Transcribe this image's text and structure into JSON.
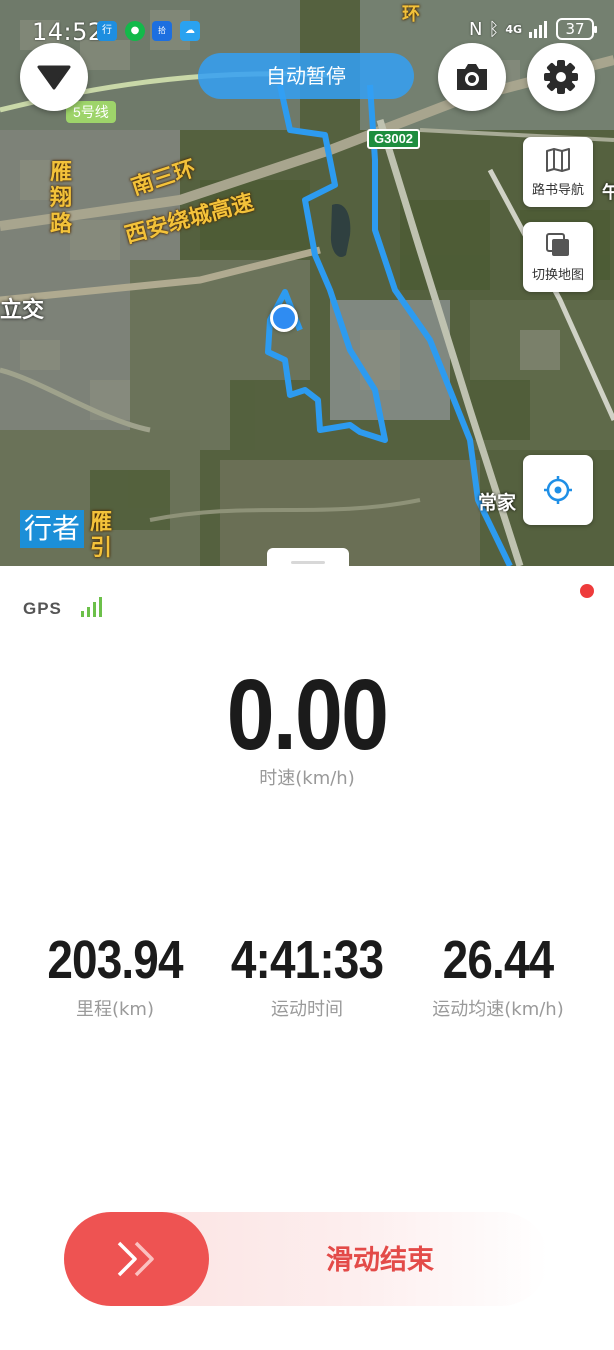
{
  "status_bar": {
    "time": "14:52",
    "network": "4G",
    "battery": "37"
  },
  "map": {
    "pause_status": "自动暂停",
    "road_badge": "G3002",
    "metro_badge": "5号线",
    "labels": {
      "road_ring": "南三环",
      "road_bypass": "西安绕城高速",
      "road_yanxiang": "雁翔路",
      "road_yanyin": "雁引",
      "interchange": "立交",
      "village": "常家",
      "top_fragment": "环",
      "right_fragment": "午"
    },
    "logo": "行者",
    "route_color": "#2d9bf0",
    "buttons": {
      "roadbook_nav": "路书导航",
      "switch_map": "切换地图"
    }
  },
  "panel": {
    "gps_label": "GPS",
    "gps_bars": 4,
    "speed": {
      "value": "0.00",
      "label": "时速(km/h)"
    },
    "stats": [
      {
        "value": "203.94",
        "label": "里程(km)"
      },
      {
        "value": "4:41:33",
        "label": "运动时间"
      },
      {
        "value": "26.44",
        "label": "运动均速(km/h)"
      }
    ],
    "slider": {
      "label": "滑动结束"
    },
    "accent_color": "#ee5352"
  }
}
